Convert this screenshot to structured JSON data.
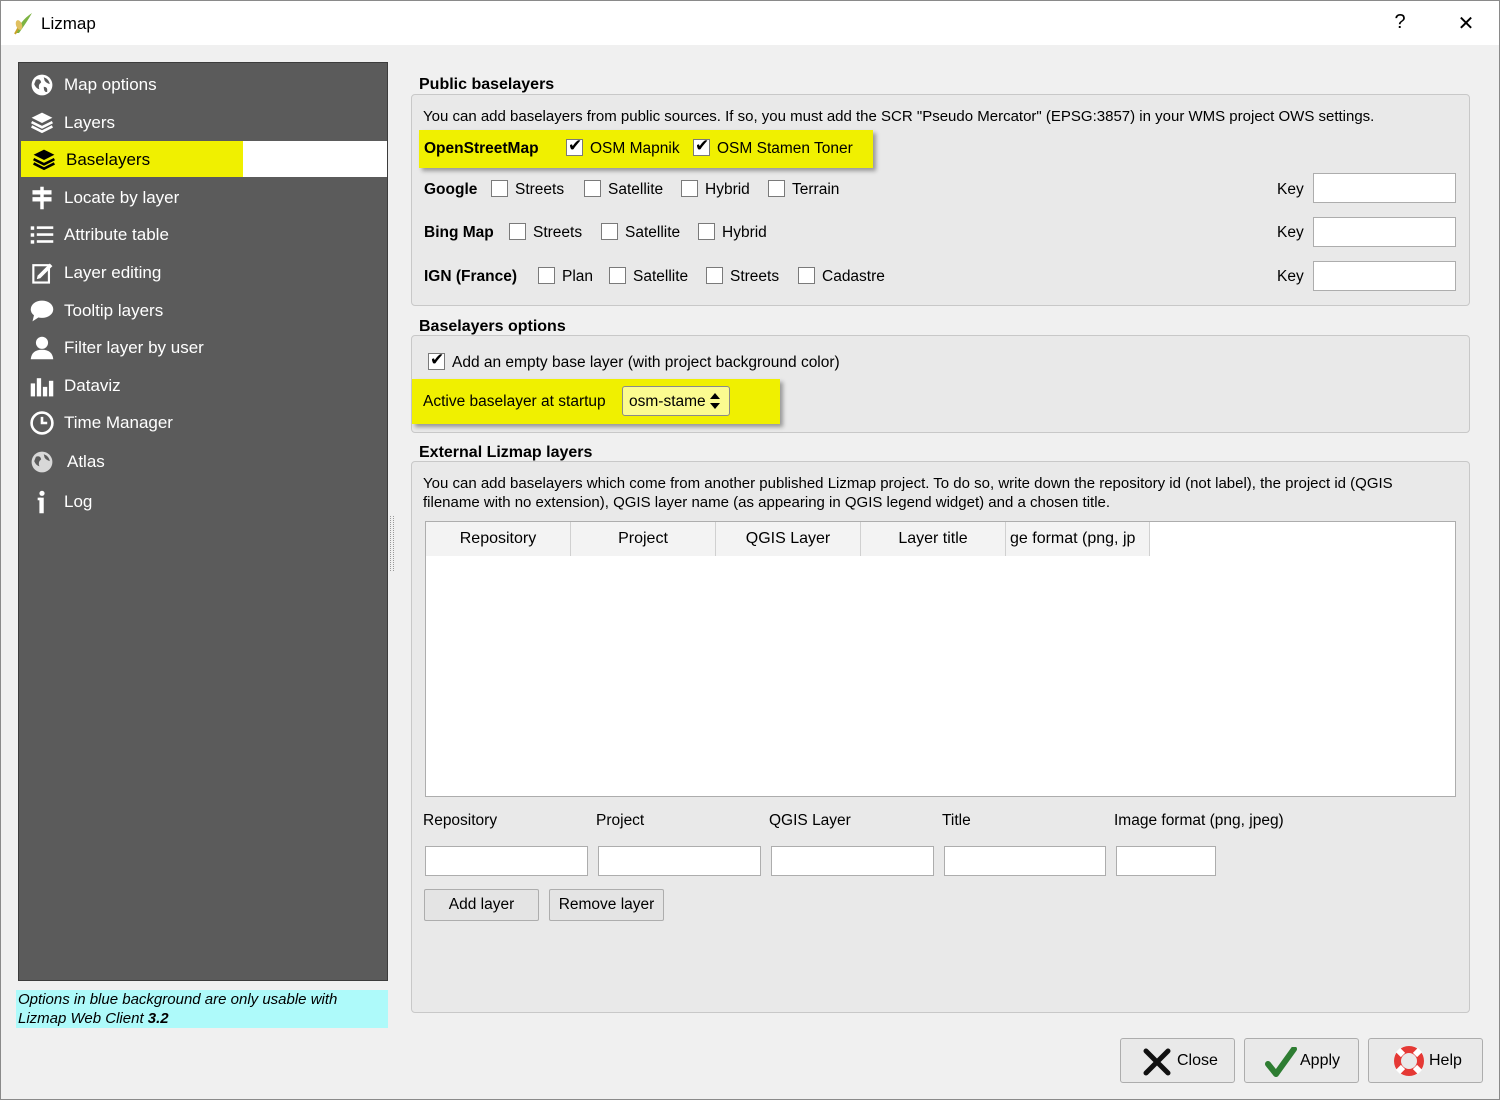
{
  "window": {
    "title": "Lizmap",
    "help_glyph": "?",
    "close_glyph": "✕"
  },
  "sidebar": {
    "items": [
      {
        "label": "Map options",
        "icon": "globe-icon"
      },
      {
        "label": "Layers",
        "icon": "layers-icon"
      },
      {
        "label": "Baselayers",
        "icon": "layers-icon",
        "selected": true
      },
      {
        "label": "Locate by layer",
        "icon": "signpost-icon"
      },
      {
        "label": "Attribute table",
        "icon": "list-icon"
      },
      {
        "label": "Layer editing",
        "icon": "edit-icon"
      },
      {
        "label": "Tooltip layers",
        "icon": "speech-bubble-icon"
      },
      {
        "label": "Filter layer by user",
        "icon": "user-icon"
      },
      {
        "label": "Dataviz",
        "icon": "bar-chart-icon"
      },
      {
        "label": "Time Manager",
        "icon": "clock-icon"
      },
      {
        "label": "Atlas",
        "icon": "globe-icon"
      },
      {
        "label": "Log",
        "icon": "info-icon"
      }
    ],
    "note_line1": "Options in blue background are only usable with",
    "note_line2_prefix": "Lizmap Web Client ",
    "note_line2_version": "3.2"
  },
  "public_baselayers": {
    "title": "Public baselayers",
    "description": "You can add baselayers from public sources. If so, you must add the SCR \"Pseudo Mercator\" (EPSG:3857) in your WMS project OWS settings.",
    "osm": {
      "label": "OpenStreetMap",
      "mapnik": "OSM Mapnik",
      "mapnik_checked": true,
      "stamen": "OSM Stamen Toner",
      "stamen_checked": true
    },
    "google": {
      "label": "Google",
      "streets": "Streets",
      "satellite": "Satellite",
      "hybrid": "Hybrid",
      "terrain": "Terrain",
      "key_label": "Key",
      "key_value": ""
    },
    "bing": {
      "label": "Bing Map",
      "streets": "Streets",
      "satellite": "Satellite",
      "hybrid": "Hybrid",
      "key_label": "Key",
      "key_value": ""
    },
    "ign": {
      "label": "IGN (France)",
      "plan": "Plan",
      "satellite": "Satellite",
      "streets": "Streets",
      "cadastre": "Cadastre",
      "key_label": "Key",
      "key_value": ""
    }
  },
  "baselayers_options": {
    "title": "Baselayers options",
    "empty_base_label": "Add an empty base layer (with project background color)",
    "empty_base_checked": true,
    "active_label": "Active baselayer at startup",
    "active_value": "osm-stame"
  },
  "external_layers": {
    "title": "External Lizmap layers",
    "description_line1": "You can add baselayers which come from another published Lizmap project. To do so, write down the repository id (not label), the project id (QGIS",
    "description_line2": "filename with no extension), QGIS layer name (as appearing in QGIS legend widget) and a chosen title.",
    "columns": [
      "Repository",
      "Project",
      "QGIS Layer",
      "Layer title",
      "ge format (png, jp"
    ],
    "form_labels": {
      "repository": "Repository",
      "project": "Project",
      "qgis_layer": "QGIS Layer",
      "title": "Title",
      "image_format": "Image format (png, jpeg)"
    },
    "add_button": "Add layer",
    "remove_button": "Remove layer"
  },
  "footer": {
    "close": "Close",
    "apply": "Apply",
    "help": "Help"
  },
  "colors": {
    "sidebar_bg": "#5b5b5b",
    "highlight": "#f0f000",
    "note_bg": "#aefafa"
  }
}
